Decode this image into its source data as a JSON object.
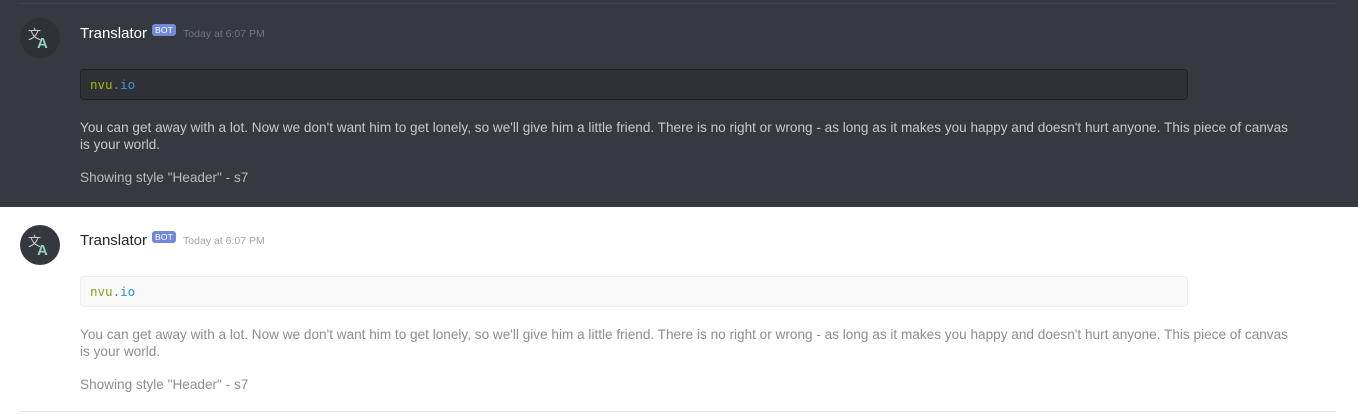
{
  "messages": [
    {
      "theme": "dark",
      "avatar_icon": "translate-icon",
      "username": "Translator",
      "badge": "BOT",
      "timestamp": "Today at 6:07 PM",
      "code": {
        "name": "nvu",
        "dot": ".",
        "ext": "io"
      },
      "body": "You can get away with a lot. Now we don't want him to get lonely, so we'll give him a little friend. There is no right or wrong - as long as it makes you happy and doesn't hurt anyone. This piece of canvas is your world.",
      "style_line": "Showing style \"Header\" - s7"
    },
    {
      "theme": "light",
      "avatar_icon": "translate-icon",
      "username": "Translator",
      "badge": "BOT",
      "timestamp": "Today at 6:07 PM",
      "code": {
        "name": "nvu",
        "dot": ".",
        "ext": "io"
      },
      "body": "You can get away with a lot. Now we don't want him to get lonely, so we'll give him a little friend. There is no right or wrong - as long as it makes you happy and doesn't hurt anyone. This piece of canvas is your world.",
      "style_line": "Showing style \"Header\" - s7"
    }
  ],
  "colors": {
    "dark_bg": "#36393f",
    "light_bg": "#ffffff",
    "badge_bg": "#7289da",
    "code_name": "#a0b80f",
    "code_ext": "#3a95d6"
  }
}
